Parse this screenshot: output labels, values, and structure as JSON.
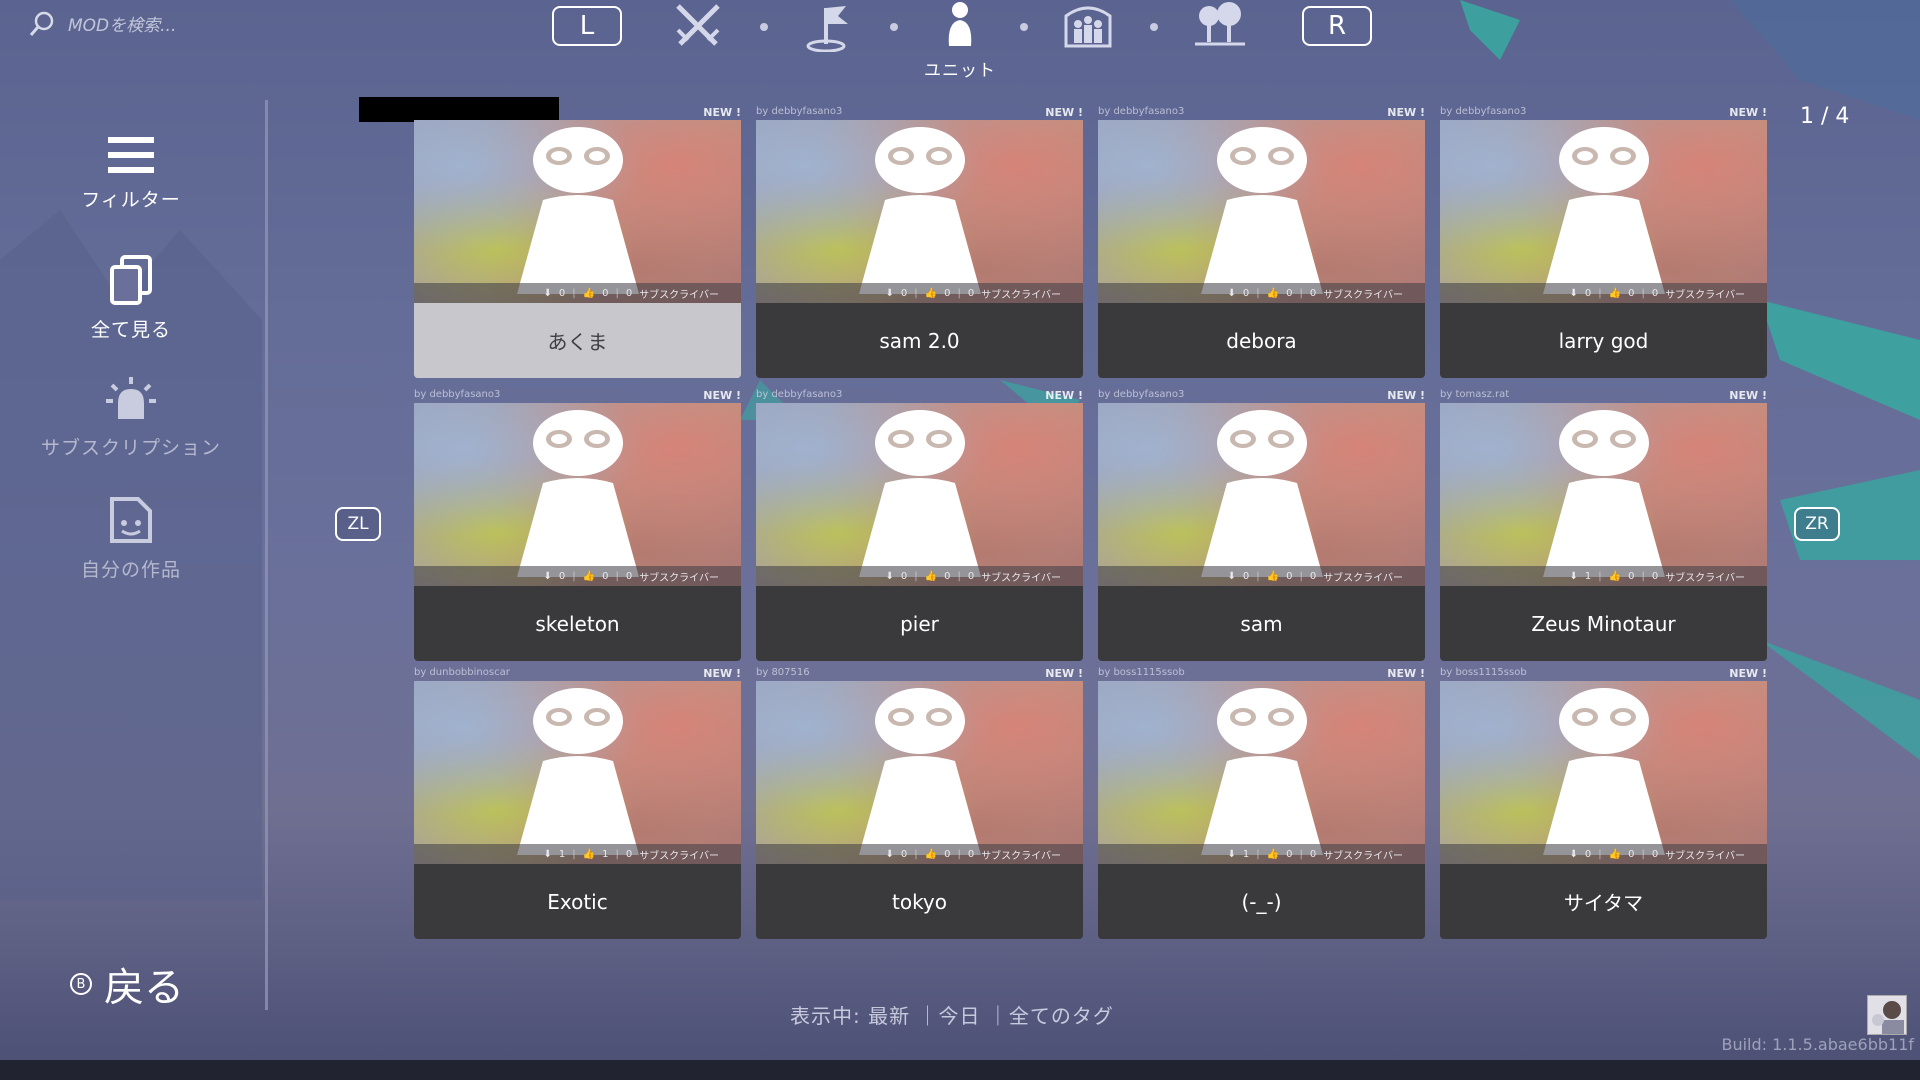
{
  "search": {
    "placeholder": "MODを検索..."
  },
  "nav": {
    "bumper_left": "L",
    "bumper_right": "R",
    "active_label": "ユニット"
  },
  "sidebar": {
    "items": [
      {
        "label": "フィルター"
      },
      {
        "label": "全て見る"
      },
      {
        "label": "サブスクリプション"
      },
      {
        "label": "自分の作品"
      }
    ],
    "back": {
      "button_glyph": "B",
      "label": "戻る"
    }
  },
  "pagination": {
    "text": "1 / 4",
    "prev_label": "ZL",
    "next_label": "ZR"
  },
  "cards": [
    {
      "name": "あくま",
      "author": "",
      "new": "NEW !",
      "downloads": "0",
      "likes": "0",
      "subs": "0",
      "subs_label": "サブスクライバー"
    },
    {
      "name": "sam 2.0",
      "author": "by debbyfasano3",
      "new": "NEW !",
      "downloads": "0",
      "likes": "0",
      "subs": "0",
      "subs_label": "サブスクライバー"
    },
    {
      "name": "debora",
      "author": "by debbyfasano3",
      "new": "NEW !",
      "downloads": "0",
      "likes": "0",
      "subs": "0",
      "subs_label": "サブスクライバー"
    },
    {
      "name": "larry god",
      "author": "by debbyfasano3",
      "new": "NEW !",
      "downloads": "0",
      "likes": "0",
      "subs": "0",
      "subs_label": "サブスクライバー"
    },
    {
      "name": "skeleton",
      "author": "by debbyfasano3",
      "new": "NEW !",
      "downloads": "0",
      "likes": "0",
      "subs": "0",
      "subs_label": "サブスクライバー"
    },
    {
      "name": "pier",
      "author": "by debbyfasano3",
      "new": "NEW !",
      "downloads": "0",
      "likes": "0",
      "subs": "0",
      "subs_label": "サブスクライバー"
    },
    {
      "name": "sam",
      "author": "by debbyfasano3",
      "new": "NEW !",
      "downloads": "0",
      "likes": "0",
      "subs": "0",
      "subs_label": "サブスクライバー"
    },
    {
      "name": "Zeus Minotaur",
      "author": "by tomasz.rat",
      "new": "NEW !",
      "downloads": "1",
      "likes": "0",
      "subs": "0",
      "subs_label": "サブスクライバー"
    },
    {
      "name": "Exotic",
      "author": "by dunbobbinoscar",
      "new": "NEW !",
      "downloads": "1",
      "likes": "1",
      "subs": "0",
      "subs_label": "サブスクライバー"
    },
    {
      "name": "tokyo",
      "author": "by 807516",
      "new": "NEW !",
      "downloads": "0",
      "likes": "0",
      "subs": "0",
      "subs_label": "サブスクライバー"
    },
    {
      "name": "(-_-)",
      "author": "by boss1115ssob",
      "new": "NEW !",
      "downloads": "1",
      "likes": "0",
      "subs": "0",
      "subs_label": "サブスクライバー"
    },
    {
      "name": "サイタマ",
      "author": "by boss1115ssob",
      "new": "NEW !",
      "downloads": "0",
      "likes": "0",
      "subs": "0",
      "subs_label": "サブスクライバー"
    }
  ],
  "footer": {
    "showing_label": "表示中:",
    "sort": "最新",
    "period": "今日",
    "tags": "全てのタグ",
    "build": "Build: 1.1.5.abae6bb11f"
  },
  "colors": {
    "accent_teal": "#3aa5a0",
    "card_title_bg": "#3a3a3d",
    "selected_card_bg": "#c8c8cc"
  }
}
